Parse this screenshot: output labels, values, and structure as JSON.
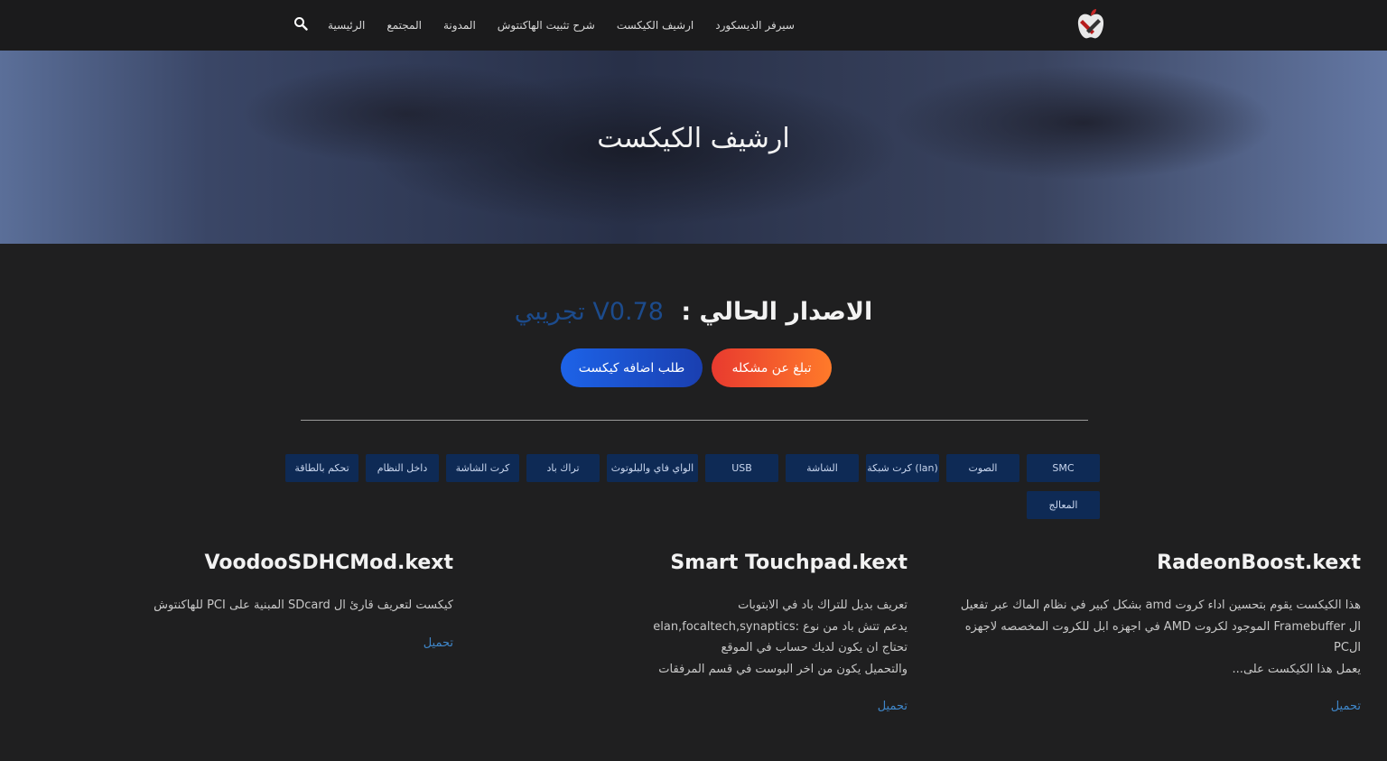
{
  "header": {
    "nav": [
      {
        "name": "nav-home",
        "label": "الرئيسية"
      },
      {
        "name": "nav-community",
        "label": "المجتمع"
      },
      {
        "name": "nav-blog",
        "label": "المدونة"
      },
      {
        "name": "nav-install-guide",
        "label": "شرح تثبيت الهاكنتوش"
      },
      {
        "name": "nav-kext-archive",
        "label": "ارشيف الكيكست"
      },
      {
        "name": "nav-discord",
        "label": "سيرفر الديسكورد"
      }
    ],
    "icons": {
      "logo": "apple-tools-logo",
      "search": "search-icon"
    }
  },
  "hero": {
    "title": "ارشيف الكيكست"
  },
  "version": {
    "label": "الاصدار الحالي :",
    "value": "V0.78 تجريبي"
  },
  "actions": {
    "report_label": "تبلغ عن مشكله",
    "request_label": "طلب اضافه كيكست"
  },
  "categories": [
    "SMC",
    "الصوت",
    "كرت شبكة (lan)",
    "الشاشة",
    "USB",
    "الواي فاي والبلوتوث",
    "تراك باد",
    "كرت الشاشة",
    "داخل النظام",
    "تحكم بالطاقة",
    "المعالج"
  ],
  "kexts": [
    {
      "title": "RadeonBoost.kext",
      "lines": [
        "هذا الكيكست يقوم بتحسين اداء كروت amd بشكل كبير في نظام الماك عبر تفعيل",
        "ال Framebuffer الموجود لكروت AMD في اجهزه ابل للكروت المخصصه لاجهزه الPC",
        "يعمل هذا الكيكست على..."
      ],
      "link": "تحميل"
    },
    {
      "title": "Smart Touchpad.kext",
      "lines": [
        "تعريف بديل للتراك باد في الابتوبات",
        "يدعم تتش باد من نوع :elan,focaltech,synaptics",
        "تحتاج ان يكون لديك حساب في الموقع",
        "والتحميل يكون من اخر البوست في قسم المرفقات"
      ],
      "link": "تحميل"
    },
    {
      "title": "VoodooSDHCMod.kext",
      "lines": [
        "كيكست لتعريف قارئ ال SDcard المبنية على PCI للهاكنتوش"
      ],
      "link": "تحميل"
    }
  ],
  "colors": {
    "accent_blue": "#1c4b8c",
    "link_blue": "#3f86c8",
    "category_bg": "#0e2a55",
    "report_btn": "#e83a2f",
    "request_btn": "#1d63e8"
  }
}
